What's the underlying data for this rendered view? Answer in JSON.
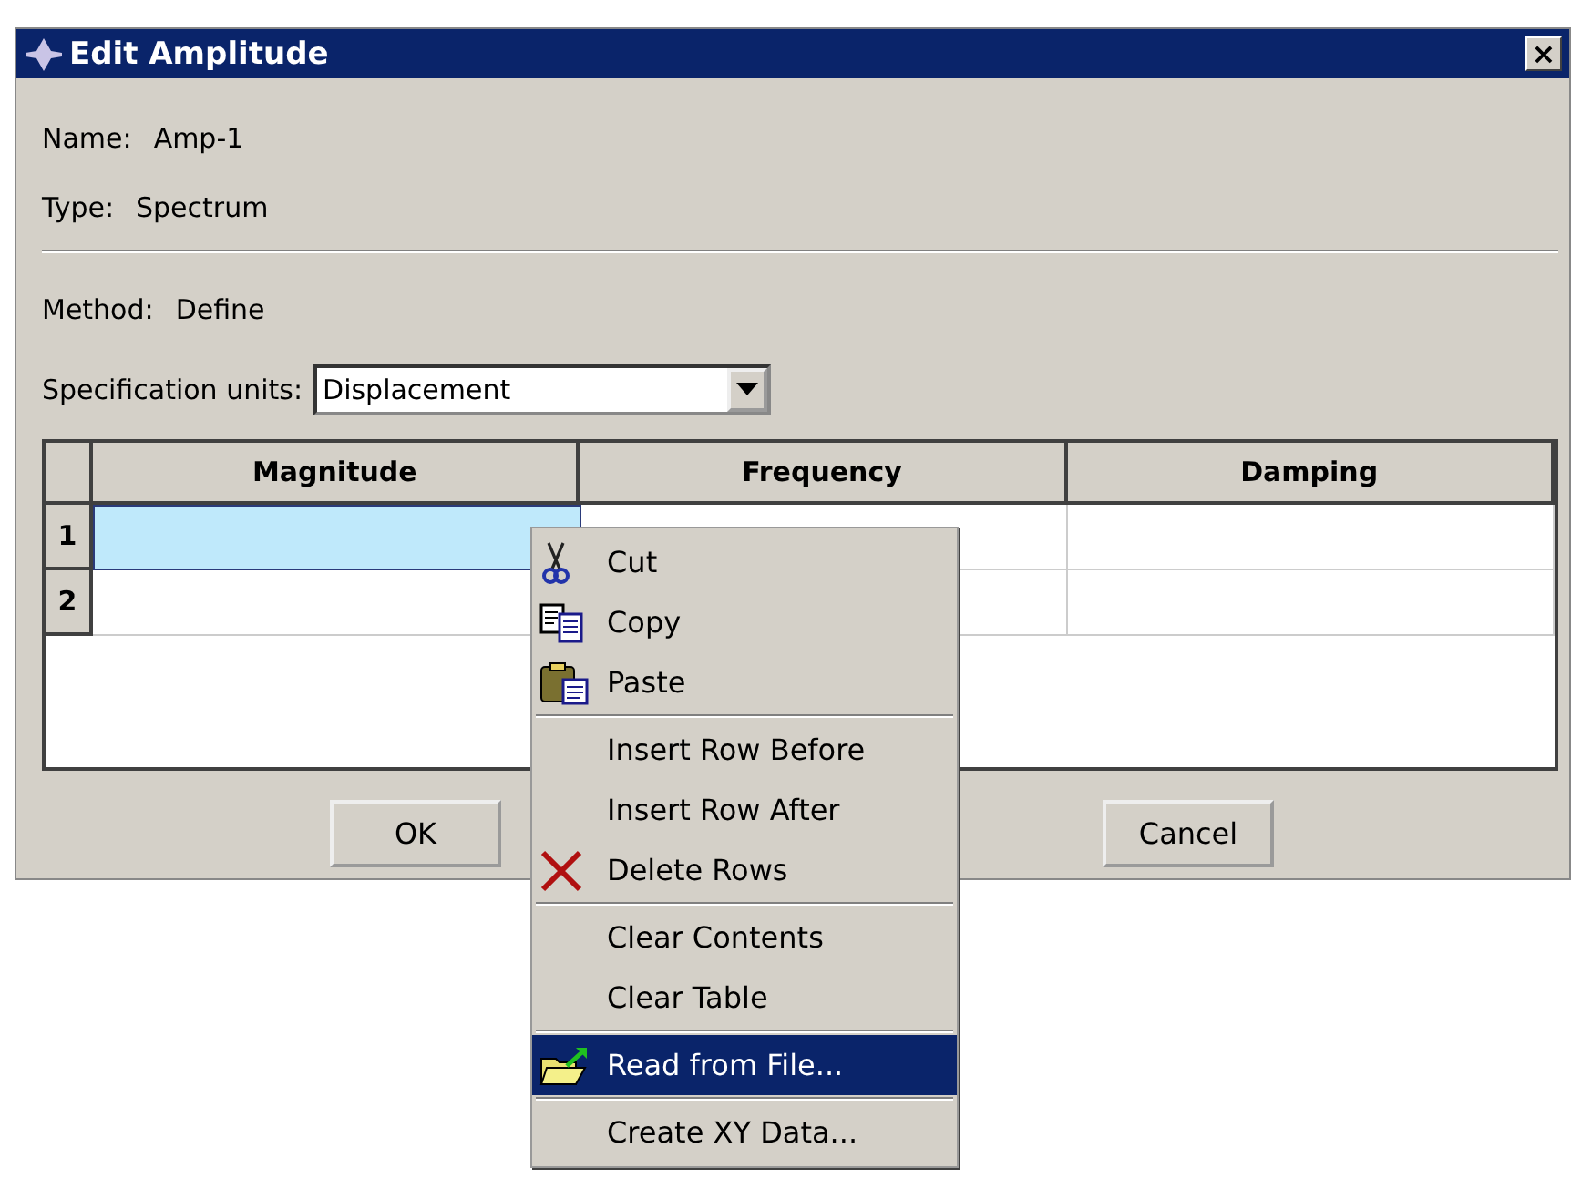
{
  "window": {
    "title": "Edit Amplitude",
    "close": "×"
  },
  "fields": [
    {
      "label": "Name:",
      "value": "Amp-1"
    },
    {
      "label": "Type:",
      "value": "Spectrum"
    }
  ],
  "method": {
    "label": "Method:",
    "value": "Define"
  },
  "units": {
    "label": "Specification units:",
    "value": "Displacement"
  },
  "table": {
    "columns": [
      "Magnitude",
      "Frequency",
      "Damping"
    ],
    "rows": [
      {
        "header": "1",
        "cells": [
          {
            "selected": true
          },
          {
            "selected": false
          },
          {
            "selected": false
          }
        ]
      },
      {
        "header": "2",
        "cells": [
          {
            "selected": false
          },
          {
            "selected": false
          },
          {
            "selected": false
          }
        ]
      }
    ]
  },
  "buttons": [
    "OK",
    "Cancel"
  ],
  "context_menu": {
    "groups": [
      [
        {
          "label": "Cut",
          "selected": false
        },
        {
          "label": "Copy",
          "selected": false
        },
        {
          "label": "Paste",
          "selected": false
        }
      ],
      [
        {
          "label": "Insert Row Before",
          "selected": false
        },
        {
          "label": "Insert Row After",
          "selected": false
        },
        {
          "label": "Delete Rows",
          "selected": false
        }
      ],
      [
        {
          "label": "Clear Contents",
          "selected": false
        },
        {
          "label": "Clear Table",
          "selected": false
        }
      ],
      [
        {
          "label": "Read from File...",
          "selected": true
        }
      ],
      [
        {
          "label": "Create XY Data...",
          "selected": false
        }
      ]
    ]
  }
}
